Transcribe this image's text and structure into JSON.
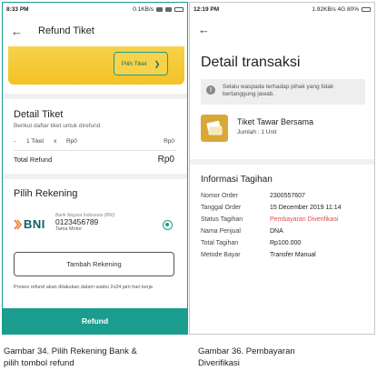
{
  "left": {
    "status_time": "8:33 PM",
    "status_right": "0.1KB/s",
    "title": "Refund Tiket",
    "pilih_tiket": "Pilih Tiket",
    "detail_title": "Detail Tiket",
    "detail_sub": "Berikut daftar tiket untuk direfund",
    "row_dash": "-",
    "row_qty": "1 Tiket",
    "row_x": "x",
    "row_price": "Rp0",
    "row_subtotal": "Rp0",
    "total_label": "Total Refund",
    "total_value": "Rp0",
    "rekening_title": "Pilih Rekening",
    "bank_logo_text": "BNI",
    "bank_name": "Bank Negara Indonesia (BNI)",
    "bank_account": "0123456789",
    "bank_owner": "Tama Motor",
    "tambah_button": "Tambah Rekening",
    "note": "Proses refund akan dilakukan dalam waktu 2x24 jam hari kerja",
    "refund_button": "Refund"
  },
  "right": {
    "status_time": "12:19 PM",
    "status_right": "1.92KB/s  4G  80%",
    "title": "Detail transaksi",
    "warning": "Selalu waspada terhadap pihak yang tidak bertanggung jawab.",
    "ticket_name": "Tiket Tawar Bersama",
    "ticket_qty": "Jumlah : 1 Unit",
    "invoice_title": "Informasi Tagihan",
    "invoice": [
      {
        "key": "Nomor Order",
        "value": "2300557607"
      },
      {
        "key": "Tanggal Order",
        "value": "15 December 2019 11:14"
      },
      {
        "key": "Status Tagihan",
        "value": "Pembayaran Diverifikasi"
      },
      {
        "key": "Nama Penjual",
        "value": "DNA"
      },
      {
        "key": "Total Tagihan",
        "value": "Rp100.000"
      },
      {
        "key": "Metode Bayar",
        "value": "Transfer Manual"
      }
    ]
  },
  "captions": {
    "left_line1": "Gambar 34. Pilih Rekening Bank &",
    "left_line2": "pilih tombol refund",
    "right_line1": "Gambar 36. Pembayaran",
    "right_line2": "Diverifikasi"
  },
  "colors": {
    "accent": "#1a9d8e",
    "banner": "#f3c226",
    "status_verified": "#d9534f"
  }
}
